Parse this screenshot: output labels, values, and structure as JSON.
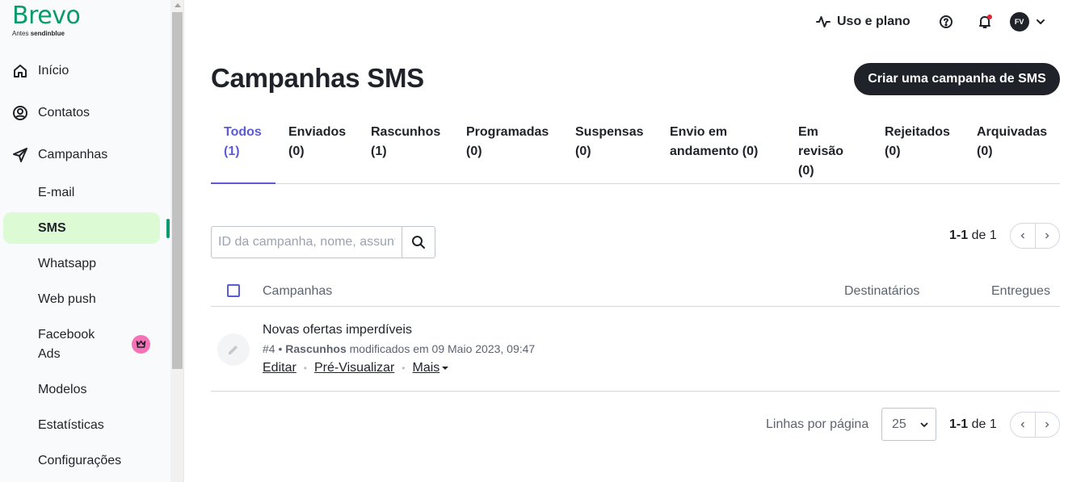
{
  "brand": {
    "name": "Brevo",
    "sub_prefix": "Antes",
    "sub_name": "sendinblue"
  },
  "sidebar": {
    "main_items": [
      {
        "label": "Início",
        "icon": "home-icon"
      },
      {
        "label": "Contatos",
        "icon": "contacts-icon"
      },
      {
        "label": "Campanhas",
        "icon": "send-icon"
      }
    ],
    "sub_items": [
      {
        "label": "E-mail"
      },
      {
        "label": "SMS",
        "active": true
      },
      {
        "label": "Whatsapp"
      },
      {
        "label": "Web push"
      },
      {
        "label": "Facebook Ads",
        "badge": "crown-icon"
      },
      {
        "label": "Modelos"
      },
      {
        "label": "Estatísticas"
      },
      {
        "label": "Configurações"
      }
    ]
  },
  "topbar": {
    "usage_label": "Uso e plano",
    "avatar_initials": "FV"
  },
  "page": {
    "title": "Campanhas SMS",
    "create_button": "Criar uma campanha de SMS"
  },
  "tabs": [
    {
      "line1": "Todos",
      "line2": "(1)",
      "active": true
    },
    {
      "line1": "Enviados",
      "line2": "(0)"
    },
    {
      "line1": "Rascunhos",
      "line2": "(1)"
    },
    {
      "line1": "Programadas",
      "line2": "(0)"
    },
    {
      "line1": "Suspensas",
      "line2": "(0)"
    },
    {
      "line1": "Envio em",
      "line2": "andamento (0)"
    },
    {
      "line1": "Em",
      "line2": "revisão",
      "line3": "(0)"
    },
    {
      "line1": "Rejeitados",
      "line2": "(0)"
    },
    {
      "line1": "Arquivadas",
      "line2": "(0)"
    }
  ],
  "search": {
    "placeholder": "ID da campanha, nome, assunto"
  },
  "pagination": {
    "range": "1-1",
    "of_label": "de 1"
  },
  "table": {
    "headers": {
      "campaigns": "Campanhas",
      "recipients": "Destinatários",
      "delivered": "Entregues"
    },
    "rows": [
      {
        "name": "Novas ofertas imperdíveis",
        "id": "#4",
        "status": "Rascunhos",
        "modified": "modificados em 09 Maio 2023, 09:47",
        "actions": {
          "edit": "Editar",
          "preview": "Pré-Visualizar",
          "more": "Mais"
        }
      }
    ]
  },
  "footer": {
    "rows_per_page_label": "Linhas por página",
    "rows_per_page_value": "25"
  },
  "colors": {
    "brand_green": "#0b996e",
    "active_tab": "#5b5bd6",
    "active_nav_bg": "#dcfad3",
    "notification_dot": "#e0243a",
    "crown_badge": "#f472b6"
  }
}
